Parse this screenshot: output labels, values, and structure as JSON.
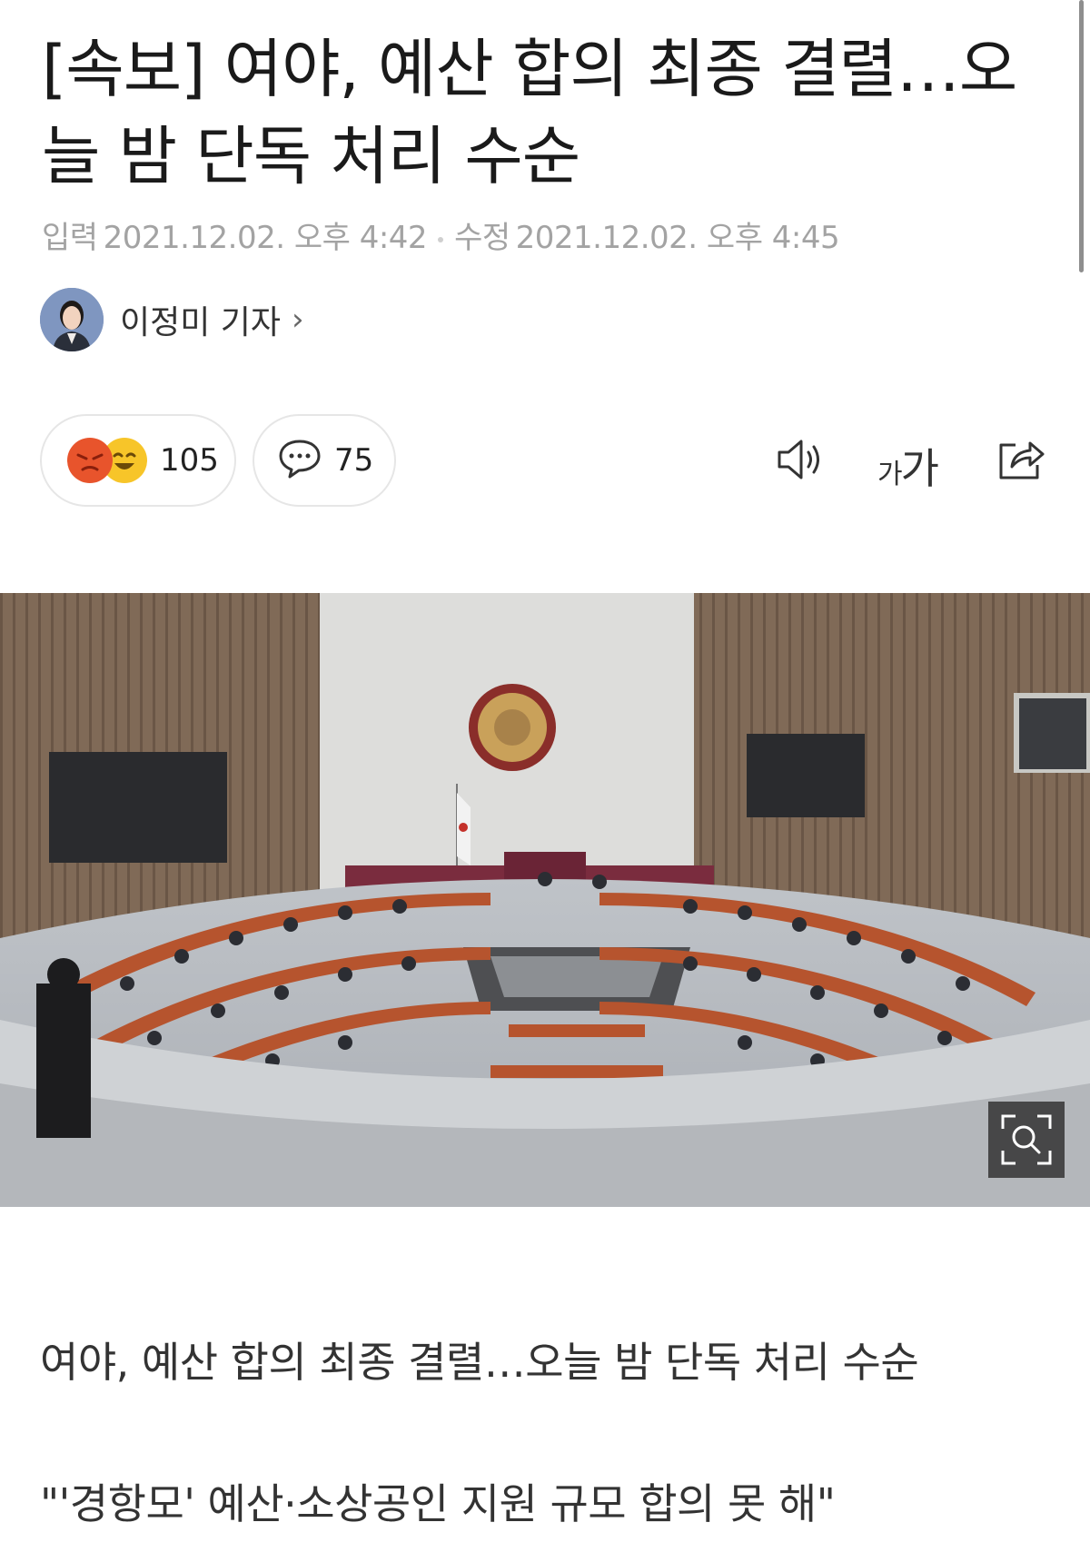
{
  "article": {
    "headline": "[속보] 여야, 예산 합의 최종 결렬…오늘 밤 단독 처리 수순",
    "input_label": "입력",
    "input_time": "2021.12.02. 오후 4:42",
    "modified_label": "수정",
    "modified_time": "2021.12.02. 오후 4:45",
    "author": "이정미 기자",
    "subhead": "여야, 예산 합의 최종 결렬…오늘 밤 단독 처리 수순",
    "quote": "\"'경항모' 예산·소상공인 지원 규모 합의 못 해\""
  },
  "reactions": {
    "count": "105",
    "icons": [
      "angry-emoji",
      "laugh-emoji"
    ]
  },
  "comments": {
    "count": "75",
    "icon": "speech-bubble-icon"
  },
  "toolbar": {
    "font_label_small": "가",
    "font_label_large": "가",
    "icons": [
      "speaker-icon",
      "font-size-icon",
      "share-icon"
    ]
  },
  "photo": {
    "description_icon": "zoom-icon"
  },
  "colors": {
    "angry": "#e8542c",
    "laugh": "#f7c529",
    "meta_gray": "#a3a3a3",
    "pill_border": "#e6e6e6"
  }
}
